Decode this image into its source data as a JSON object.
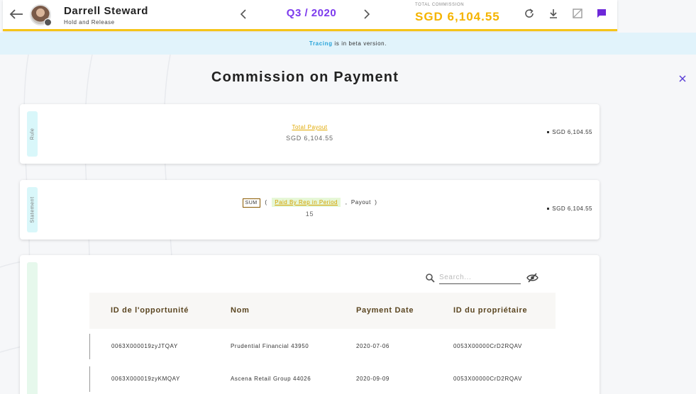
{
  "header": {
    "user_name": "Darrell Steward",
    "user_subtitle": "Hold and Release",
    "period": "Q3 / 2020",
    "total_commission_label": "TOTAL COMMISSION",
    "total_commission_value": "SGD 6,104.55",
    "accent_color": "#f5c518",
    "period_color": "#7c3aed",
    "icons": [
      "back-arrow-icon",
      "chevron-left-icon",
      "chevron-right-icon",
      "refresh-icon",
      "download-icon",
      "image-icon",
      "chat-icon"
    ]
  },
  "banner": {
    "highlight": "Tracing",
    "text": " is in beta version."
  },
  "page": {
    "title": "Commission on Payment"
  },
  "rule_card": {
    "tag": "Rule",
    "link": "Total Payout",
    "value": "SGD 6,104.55",
    "right_value": "SGD 6,104.55"
  },
  "statement_card": {
    "tag": "Statement",
    "sum_label": "SUM",
    "open_paren": "(",
    "paid_link": "Paid By Rep in Period",
    "comma": ",",
    "payout": "Payout",
    "close_paren": ")",
    "value": "15",
    "right_value": "SGD 6,104.55"
  },
  "table_card": {
    "search_placeholder": "Search...",
    "columns": [
      "ID de l'opportunité",
      "Nom",
      "Payment Date",
      "ID du propriétaire"
    ],
    "rows": [
      [
        "0063X000019zyJTQAY",
        "Prudential Financial 43950",
        "2020-07-06",
        "0053X00000CrD2RQAV"
      ],
      [
        "0063X000019zyKMQAY",
        "Ascena Retail Group 44026",
        "2020-09-09",
        "0053X00000CrD2RQAV"
      ]
    ]
  }
}
